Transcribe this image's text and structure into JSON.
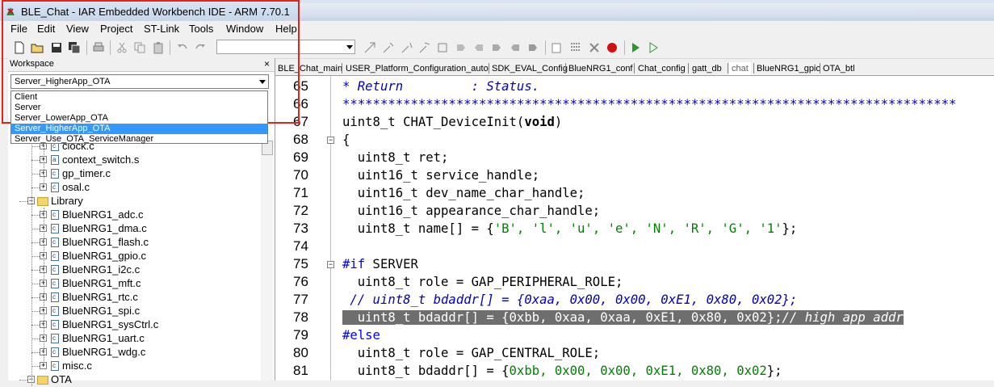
{
  "window": {
    "title": "BLE_Chat - IAR Embedded Workbench IDE - ARM 7.70.1"
  },
  "menu": {
    "items": [
      "File",
      "Edit",
      "View",
      "Project",
      "ST-Link",
      "Tools",
      "Window",
      "Help"
    ]
  },
  "workspace": {
    "header": "Workspace",
    "close": "×",
    "config_selected": "Server_HigherApp_OTA",
    "config_options": [
      "Client",
      "Server",
      "Server_LowerApp_OTA",
      "Server_HigherApp_OTA",
      "Server_Use_OTA_ServiceManager"
    ],
    "tree": [
      {
        "label": "clock.c",
        "kind": "c"
      },
      {
        "label": "context_switch.s",
        "kind": "asm"
      },
      {
        "label": "gp_timer.c",
        "kind": "c"
      },
      {
        "label": "osal.c",
        "kind": "c"
      },
      {
        "label": "Library",
        "kind": "folder"
      },
      {
        "label": "BlueNRG1_adc.c",
        "kind": "c"
      },
      {
        "label": "BlueNRG1_dma.c",
        "kind": "c"
      },
      {
        "label": "BlueNRG1_flash.c",
        "kind": "c"
      },
      {
        "label": "BlueNRG1_gpio.c",
        "kind": "c"
      },
      {
        "label": "BlueNRG1_i2c.c",
        "kind": "c"
      },
      {
        "label": "BlueNRG1_mft.c",
        "kind": "c"
      },
      {
        "label": "BlueNRG1_rtc.c",
        "kind": "c"
      },
      {
        "label": "BlueNRG1_spi.c",
        "kind": "c"
      },
      {
        "label": "BlueNRG1_sysCtrl.c",
        "kind": "c"
      },
      {
        "label": "BlueNRG1_uart.c",
        "kind": "c"
      },
      {
        "label": "BlueNRG1_wdg.c",
        "kind": "c"
      },
      {
        "label": "misc.c",
        "kind": "c"
      },
      {
        "label": "OTA",
        "kind": "folder"
      }
    ]
  },
  "tabs": [
    {
      "label": "BLE_Chat_main",
      "active": false
    },
    {
      "label": "USER_Platform_Configuration_auto",
      "active": false
    },
    {
      "label": "SDK_EVAL_Config",
      "active": false
    },
    {
      "label": "BlueNRG1_conf",
      "active": false
    },
    {
      "label": "Chat_config",
      "active": false
    },
    {
      "label": "gatt_db",
      "active": false
    },
    {
      "label": "chat",
      "active": true
    },
    {
      "label": "BlueNRG1_gpio",
      "active": false
    },
    {
      "label": "OTA_btl",
      "active": false
    }
  ],
  "editor": {
    "line_numbers": [
      "65",
      "66",
      "67",
      "68",
      "69",
      "70",
      "71",
      "72",
      "73",
      "74",
      "75",
      "76",
      "77",
      "78",
      "79",
      "80",
      "81"
    ],
    "lines": {
      "l65": "* Return         : Status.",
      "l66": "*********************************************************************************",
      "l67a": "uint8_t CHAT_DeviceInit(",
      "l67b": "void",
      "l67c": ")",
      "l68": "{",
      "l69": "  uint8_t ret;",
      "l70": "  uint16_t service_handle;",
      "l71": "  uint16_t dev_name_char_handle;",
      "l72": "  uint16_t appearance_char_handle;",
      "l73a": "  uint8_t name[] = {",
      "l73b": "'B', 'l', 'u', 'e', 'N', 'R', 'G', '1'",
      "l73c": "};",
      "l74": "",
      "l75a": "#if",
      "l75b": " SERVER",
      "l76": "  uint8_t role = GAP_PERIPHERAL_ROLE;",
      "l77": " // uint8_t bdaddr[] = {0xaa, 0x00, 0x00, 0xE1, 0x80, 0x02};",
      "l78a": "  uint8_t bdaddr[] = {0xbb, 0xaa, 0xaa, 0xE1, 0x80, 0x02};",
      "l78b": "// high app addr",
      "l79": "#else",
      "l80": "  uint8_t role = GAP_CENTRAL_ROLE;",
      "l81a": "  uint8_t bdaddr[] = {",
      "l81b": "0xbb, 0x00, 0x00, 0xE1, 0x80, 0x02",
      "l81c": "};"
    }
  }
}
